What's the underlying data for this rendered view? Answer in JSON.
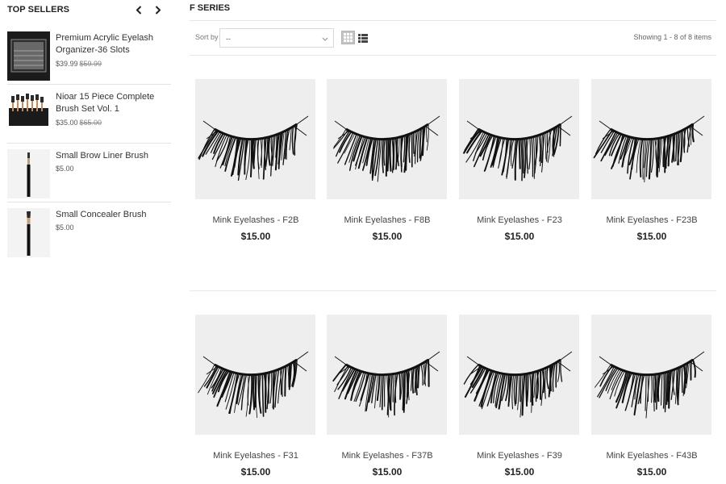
{
  "sidebar": {
    "title": "TOP SELLERS",
    "items": [
      {
        "name": "Premium Acrylic Eyelash Organizer-36 Slots",
        "price": "$39.99",
        "old_price": "$59.99",
        "thumb": "organizer"
      },
      {
        "name": "Nioar 15 Piece Complete Brush Set Vol. 1",
        "price": "$35.00",
        "old_price": "$65.00",
        "thumb": "brush-set"
      },
      {
        "name": "Small Brow Liner Brush",
        "price": "$5.00",
        "old_price": "",
        "thumb": "brush"
      },
      {
        "name": "Small Concealer Brush",
        "price": "$5.00",
        "old_price": "",
        "thumb": "brush"
      }
    ]
  },
  "main": {
    "title": "F SERIES",
    "sort_label": "Sort by",
    "sort_value": "--",
    "showing": "Showing 1 - 8 of 8 items",
    "products": [
      {
        "name": "Mink Eyelashes - F2B",
        "price": "$15.00"
      },
      {
        "name": "Mink Eyelashes - F8B",
        "price": "$15.00"
      },
      {
        "name": "Mink Eyelashes - F23",
        "price": "$15.00"
      },
      {
        "name": "Mink Eyelashes - F23B",
        "price": "$15.00"
      },
      {
        "name": "Mink Eyelashes - F31",
        "price": "$15.00"
      },
      {
        "name": "Mink Eyelashes - F37B",
        "price": "$15.00"
      },
      {
        "name": "Mink Eyelashes - F39",
        "price": "$15.00"
      },
      {
        "name": "Mink Eyelashes - F43B",
        "price": "$15.00"
      }
    ]
  },
  "icons": {
    "prev": "chevron-left-icon",
    "next": "chevron-right-icon",
    "sort": "chevron-down-icon",
    "grid_view": "grid-view-icon",
    "list_view": "list-view-icon"
  },
  "colors": {
    "background": "#ffffff",
    "text": "#333333",
    "price": "#222222",
    "image_bg": "#eeeeee",
    "lash": "#111111",
    "divider": "#e8e8e8"
  }
}
